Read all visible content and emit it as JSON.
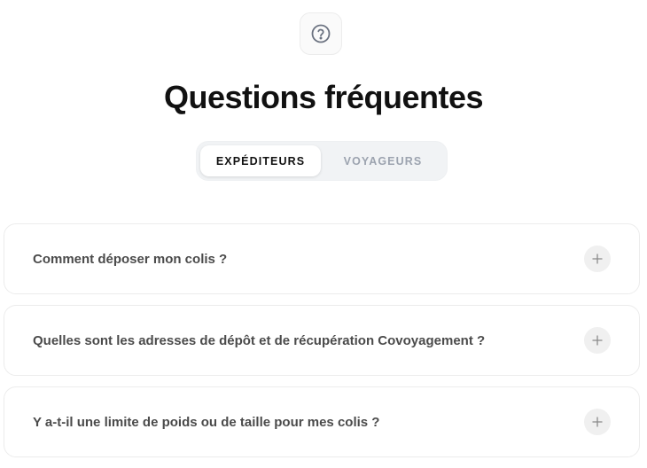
{
  "header": {
    "icon": "help-circle-icon",
    "title": "Questions fréquentes"
  },
  "tabs": [
    {
      "label": "EXPÉDITEURS",
      "active": true
    },
    {
      "label": "VOYAGEURS",
      "active": false
    }
  ],
  "faq": {
    "items": [
      {
        "question": "Comment déposer mon colis ?",
        "icon": "plus-icon"
      },
      {
        "question": "Quelles sont les adresses de dépôt et de récupération Covoyagement ?",
        "icon": "plus-icon"
      },
      {
        "question": "Y a-t-il une limite de poids ou de taille pour mes colis ?",
        "icon": "plus-icon"
      }
    ]
  },
  "colors": {
    "title": "#111111",
    "question_text": "#4b4b4b",
    "inactive_tab": "#9ca3af",
    "tab_track": "#f1f3f5",
    "card_border": "#ececec"
  }
}
